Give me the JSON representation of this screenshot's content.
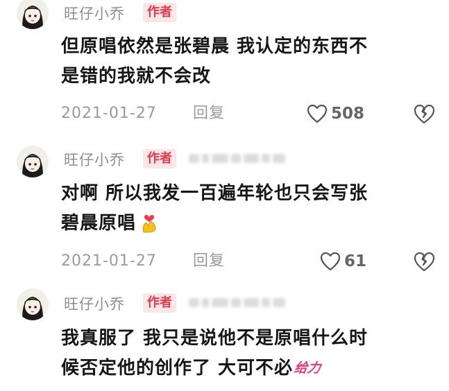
{
  "comments": [
    {
      "username": "旺仔小乔",
      "badge": "作者",
      "content_lines": [
        "但原唱依然是张碧晨 我认定的东西不",
        "是错的我就不会改"
      ],
      "date": "2021-01-27",
      "reply_label": "回复",
      "likes": "508",
      "has_blurred_text": false
    },
    {
      "username": "旺仔小乔",
      "badge": "作者",
      "content_lines": [
        "对啊 所以我发一百遍年轮也只会写张",
        "碧晨原唱"
      ],
      "trailing_sticker": "heart-hands-sticker",
      "date": "2021-01-27",
      "reply_label": "回复",
      "likes": "61",
      "has_blurred_text": true
    },
    {
      "username": "旺仔小乔",
      "badge": "作者",
      "content_lines": [
        "我真服了 我只是说他不是原唱什么时",
        "候否定他的创作了 大可不必"
      ],
      "trailing_emoji_text": "给力",
      "has_blurred_text": true
    }
  ],
  "colors": {
    "badge_bg": "#fde6e8",
    "badge_text": "#e6394b",
    "meta_text": "#9a9a9a",
    "content_text": "#161616"
  },
  "icons": {
    "like": "heart-outline-icon",
    "dislike": "broken-heart-icon",
    "avatar": "cartoon-girl-avatar"
  }
}
